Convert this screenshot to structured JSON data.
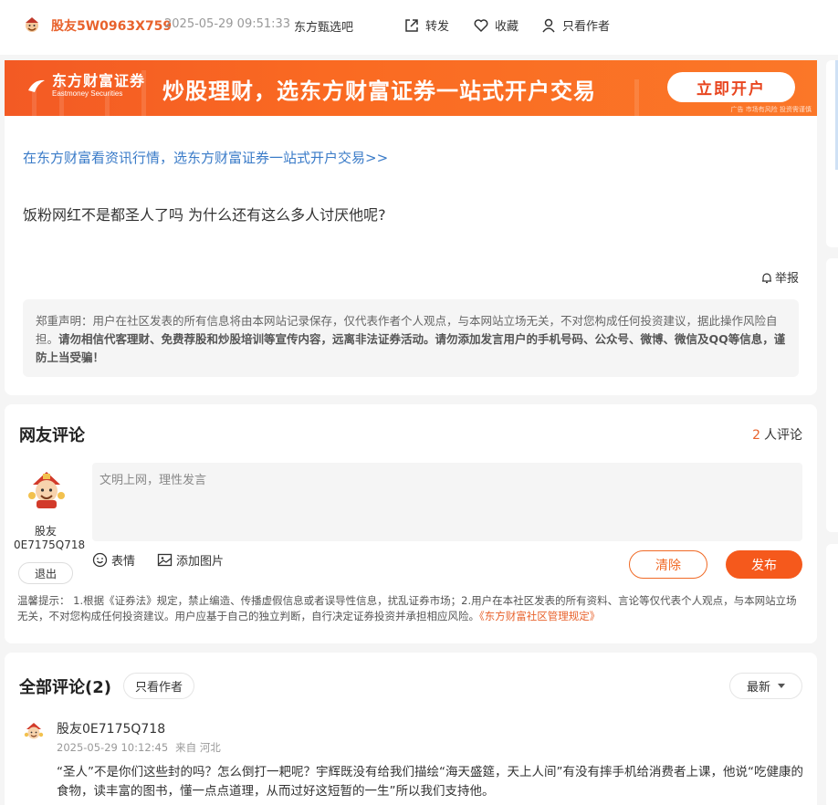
{
  "header": {
    "author": "股友5W0963X759",
    "time": "2025-05-29 09:51:33",
    "board": "东方甄选吧",
    "actions": [
      {
        "label": "转发",
        "icon": "share-icon"
      },
      {
        "label": "收藏",
        "icon": "heart-icon"
      },
      {
        "label": "只看作者",
        "icon": "user-icon"
      }
    ]
  },
  "banner": {
    "logo_cn": "东方财富证券",
    "logo_en": "Eastmoney Securities",
    "slogan": "炒股理财，选东方财富证券一站式开户交易",
    "button": "立即开户",
    "ad_tag": "广告 市场有风险 投资需谨慎"
  },
  "post": {
    "promo_link": "在东方财富看资讯行情，选东方财富证券一站式开户交易>>",
    "body": "饭粉网红不是都圣人了吗 为什么还有这么多人讨厌他呢?",
    "report": "举报",
    "disclaimer_plain": "郑重声明：用户在社区发表的所有信息将由本网站记录保存，仅代表作者个人观点，与本网站立场无关，不对您构成任何投资建议，据此操作风险自担。",
    "disclaimer_bold": "请勿相信代客理财、免费荐股和炒股培训等宣传内容，远离非法证券活动。请勿添加发言用户的手机号码、公众号、微博、微信及QQ等信息，谨防上当受骗！"
  },
  "comment_box": {
    "title": "网友评论",
    "count": "2",
    "count_suffix": "人评论",
    "user_name": "股友0E7175Q718",
    "logout": "退出",
    "placeholder": "文明上网，理性发言",
    "emoji": "表情",
    "image": "添加图片",
    "clear": "清除",
    "submit": "发布",
    "tips": "温馨提示： 1.根据《证券法》规定，禁止编造、传播虚假信息或者误导性信息，扰乱证券市场；2.用户在本社区发表的所有资料、言论等仅代表个人观点，与本网站立场无关，不对您构成任何投资建议。用户应基于自己的独立判断，自行决定证券投资并承担相应风险。",
    "tips_link": "《东方财富社区管理规定》"
  },
  "all_comments": {
    "title": "全部评论(2)",
    "only_author": "只看作者",
    "sort": "最新",
    "items": [
      {
        "name": "股友0E7175Q718",
        "time": "2025-05-29 10:12:45",
        "location": "来自 河北",
        "text": "“圣人”不是你们这些封的吗？怎么倒打一耙呢？宇辉既没有给我们描绘“海天盛筵，天上人间”有没有摔手机给消费者上课，他说“吃健康的食物，读丰富的图书，懂一点点道理，从而过好这短暂的一生”所以我们支持他。"
      }
    ]
  },
  "colors": {
    "accent": "#e8622c",
    "link": "#3a7bc8",
    "banner": "#f35a24"
  }
}
